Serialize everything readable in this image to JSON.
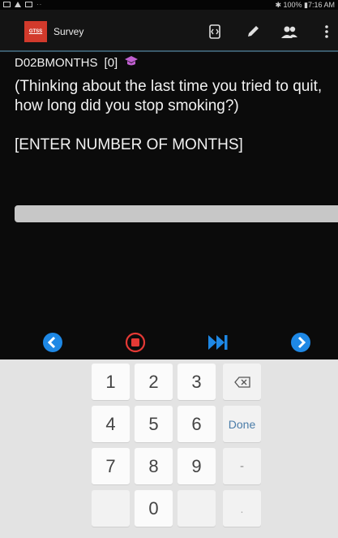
{
  "status_bar": {
    "right_text": "✱ 100% ▮7:16 AM",
    "dots": "··"
  },
  "app_bar": {
    "logo_text": "GTSS",
    "title": "Survey",
    "icons": [
      "navigate-icon",
      "pencil-icon",
      "people-icon",
      "overflow-menu-icon"
    ]
  },
  "question": {
    "variable": "D02BMONTHS",
    "value": "[0]",
    "text": "(Thinking about the last time you tried to quit, how long did you stop smoking?)",
    "instruction": "[ENTER NUMBER OF MONTHS]"
  },
  "answer": {
    "value": "",
    "placeholder": ""
  },
  "navigation": [
    "back-icon",
    "stop-icon",
    "fast-forward-icon",
    "next-icon"
  ],
  "keyboard": {
    "keys": {
      "k1": "1",
      "k2": "2",
      "k3": "3",
      "k4": "4",
      "k5": "5",
      "k6": "6",
      "k7": "7",
      "k8": "8",
      "k9": "9",
      "k0": "0",
      "done": "Done",
      "dash": "-",
      "dot": "."
    }
  },
  "colors": {
    "accent_blue": "#1e88e5",
    "stop_red": "#e53935",
    "logo_red": "#d23a2c",
    "cap_purple": "#c060d0"
  }
}
